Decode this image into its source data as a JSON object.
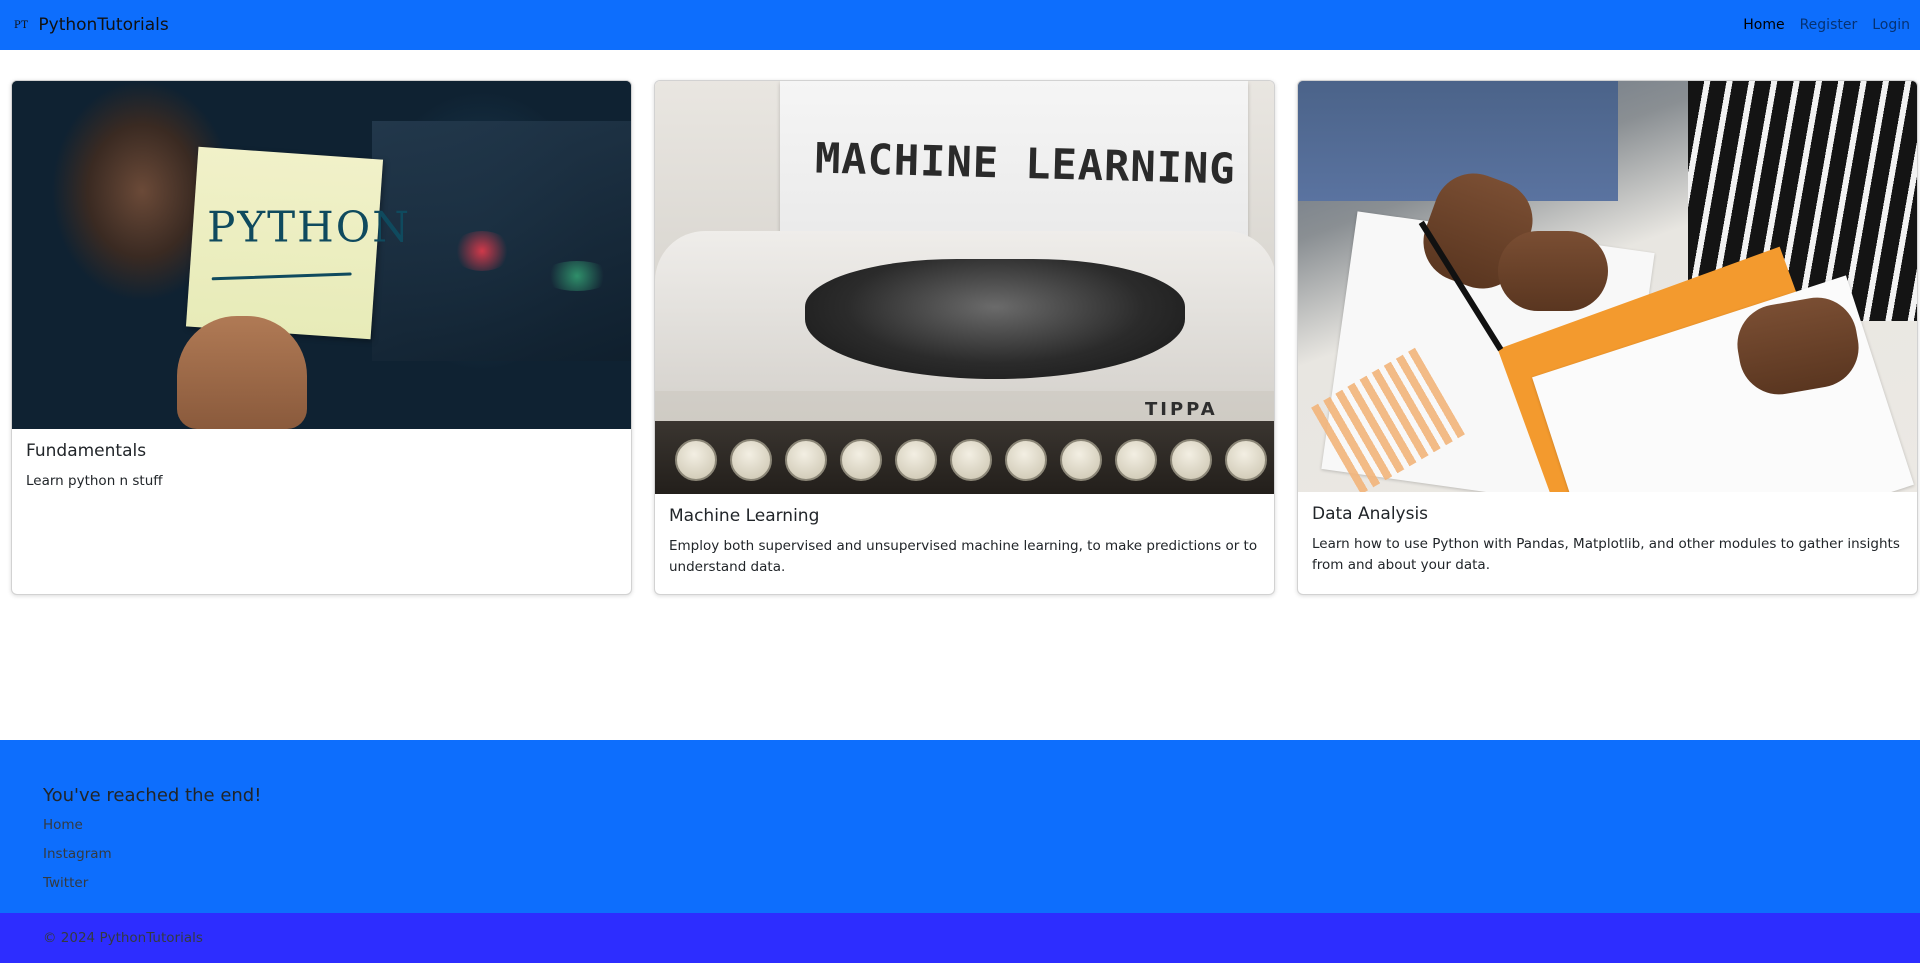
{
  "navbar": {
    "logo_text": "PT",
    "brand": "PythonTutorials",
    "links": [
      {
        "label": "Home",
        "active": true
      },
      {
        "label": "Register",
        "active": false
      },
      {
        "label": "Login",
        "active": false
      }
    ]
  },
  "cards": [
    {
      "title": "Fundamentals",
      "text": "Learn python n stuff",
      "image_note_text": "PYTHON"
    },
    {
      "title": "Machine Learning",
      "text": "Employ both supervised and unsupervised machine learning, to make predictions or to understand data.",
      "image_paper_text": "MACHINE LEARNING",
      "image_brand_text": "TIPPA"
    },
    {
      "title": "Data Analysis",
      "text": "Learn how to use Python with Pandas, Matplotlib, and other modules to gather insights from and about your data."
    }
  ],
  "footer": {
    "title": "You've reached the end!",
    "links": [
      "Home",
      "Instagram",
      "Twitter"
    ],
    "copyright": "© 2024 PythonTutorials"
  },
  "colors": {
    "primary": "#0d6efd",
    "copyright_bar": "#2d2dff"
  }
}
